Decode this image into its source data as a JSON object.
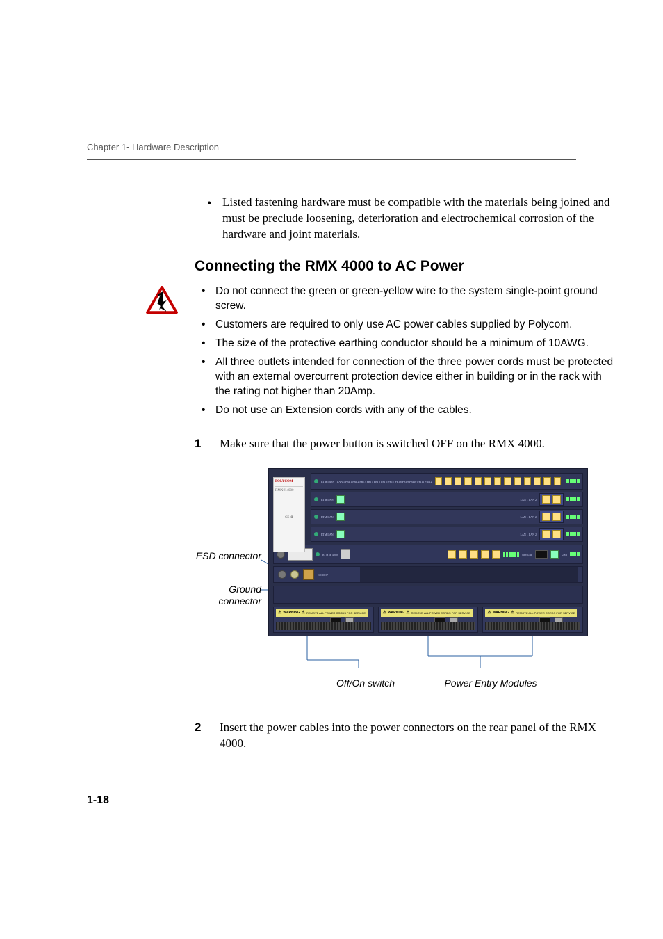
{
  "running_head": "Chapter 1- Hardware Description",
  "page_number": "1-18",
  "intro_bullets": [
    "Listed fastening hardware must be compatible with the materials being joined and must be preclude loosening, deterioration and electrochemical corrosion of the hardware and joint materials."
  ],
  "section_heading": "Connecting the RMX 4000 to AC Power",
  "warning_bullets": [
    "Do not connect the green or green-yellow wire to the system single-point ground screw.",
    "Customers are required to only use AC power cables supplied by Polycom.",
    "The size of the protective earthing conductor should be a minimum of 10AWG.",
    "All three outlets intended for connection of the three power cords must be protected with an external overcurrent protection device either in building or in the rack with the rating not higher than 20Amp.",
    "Do not use an Extension cords with any of the cables."
  ],
  "steps": [
    {
      "num": "1",
      "text": "Make sure that the power button is switched OFF on the RMX 4000."
    },
    {
      "num": "2",
      "text": "Insert the power cables into the power connectors on the rear panel of the RMX 4000."
    }
  ],
  "callouts": {
    "esd": "ESD connector",
    "ground": "Ground connector",
    "switch": "Off/On switch",
    "pems": "Power Entry Modules"
  },
  "chassis": {
    "brand": "POLYCOM",
    "model": "RMX® 4000",
    "slot_labels": {
      "top_lans": "LAN 1  PRI 1  PRI 2  PRI 3  PRI 4  PRI 5  PRI 6  PRI 7  PRI 8  PRI 9  PRI10  PRI11  PRI12",
      "rtm_isdn": "RTM ISDN",
      "rtm_lan": "RTM LAN",
      "lan12": "LAN 1   LAN 2",
      "rtm_ip": "RTM IP 4000",
      "shlf": "ShMG IP",
      "usb": "USB",
      "pwr_switch": "10/20OP",
      "psu_warn": "WARNING",
      "psu_note": "REMOVE ALL POWER CORDS FOR SERVICE"
    }
  }
}
